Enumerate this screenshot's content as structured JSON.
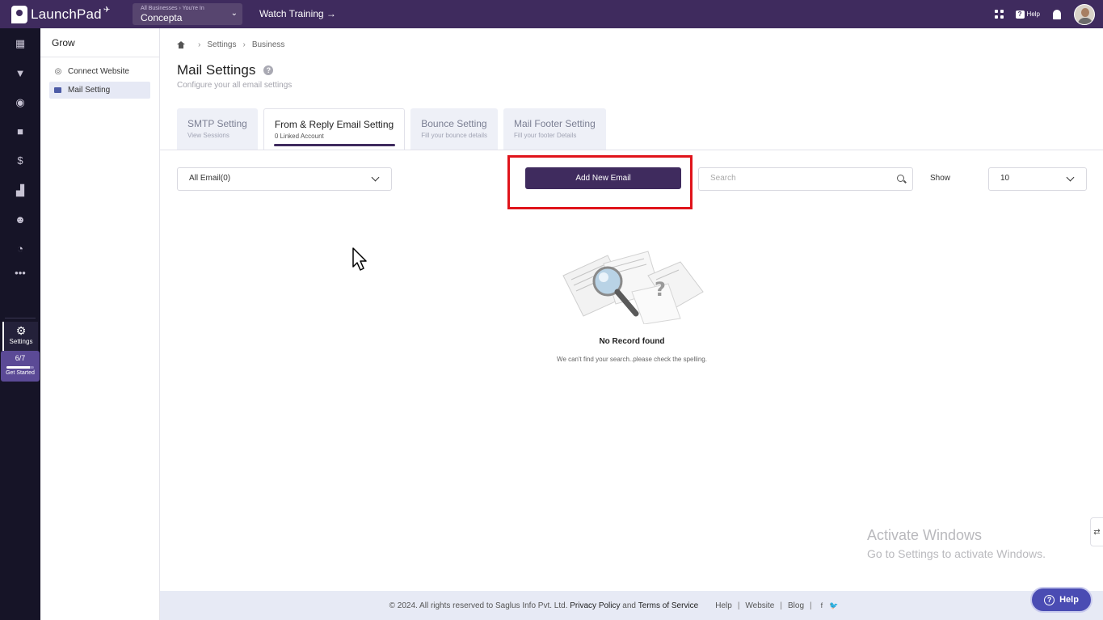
{
  "app": {
    "name": "LaunchPad"
  },
  "header": {
    "business_crumb": "All Businesses › You're In",
    "business_name": "Concepta",
    "watch_training": "Watch Training →",
    "help_label": "Help"
  },
  "rail": {
    "active_label": "Settings",
    "progress": {
      "label": "6/7",
      "fraction": 0.857,
      "cta": "Get Started"
    }
  },
  "subnav": {
    "title": "Grow",
    "items": [
      {
        "label": "Connect Website",
        "active": false
      },
      {
        "label": "Mail Setting",
        "active": true
      }
    ]
  },
  "breadcrumb": [
    "Settings",
    "Business"
  ],
  "page": {
    "title": "Mail Settings",
    "subtitle": "Configure your all email settings"
  },
  "tabs": [
    {
      "title": "SMTP Setting",
      "sub": "View Sessions",
      "active": false
    },
    {
      "title": "From & Reply Email Setting",
      "sub": "0 Linked Account",
      "active": true
    },
    {
      "title": "Bounce Setting",
      "sub": "Fill your bounce details",
      "active": false
    },
    {
      "title": "Mail Footer Setting",
      "sub": "Fill your footer Details",
      "active": false
    }
  ],
  "toolbar": {
    "filter_value": "All Email(0)",
    "add_button": "Add New Email",
    "search_placeholder": "Search",
    "show_label": "Show",
    "show_value": "10"
  },
  "empty": {
    "title": "No Record found",
    "message": "We can't find your search..please check the spelling."
  },
  "watermark": {
    "line1": "Activate Windows",
    "line2": "Go to Settings to activate Windows."
  },
  "footer": {
    "copyright": "©  2024. All rights reserved to Saglus Info Pvt. Ltd.",
    "privacy": "Privacy Policy",
    "and": "and",
    "terms": "Terms of Service",
    "help": "Help",
    "website": "Website",
    "blog": "Blog"
  },
  "help_fab": "Help",
  "colors": {
    "brand": "#3f2b5e",
    "rail_bg": "#161427",
    "highlight": "#e0141b",
    "help_fab": "#4a4cb3"
  }
}
